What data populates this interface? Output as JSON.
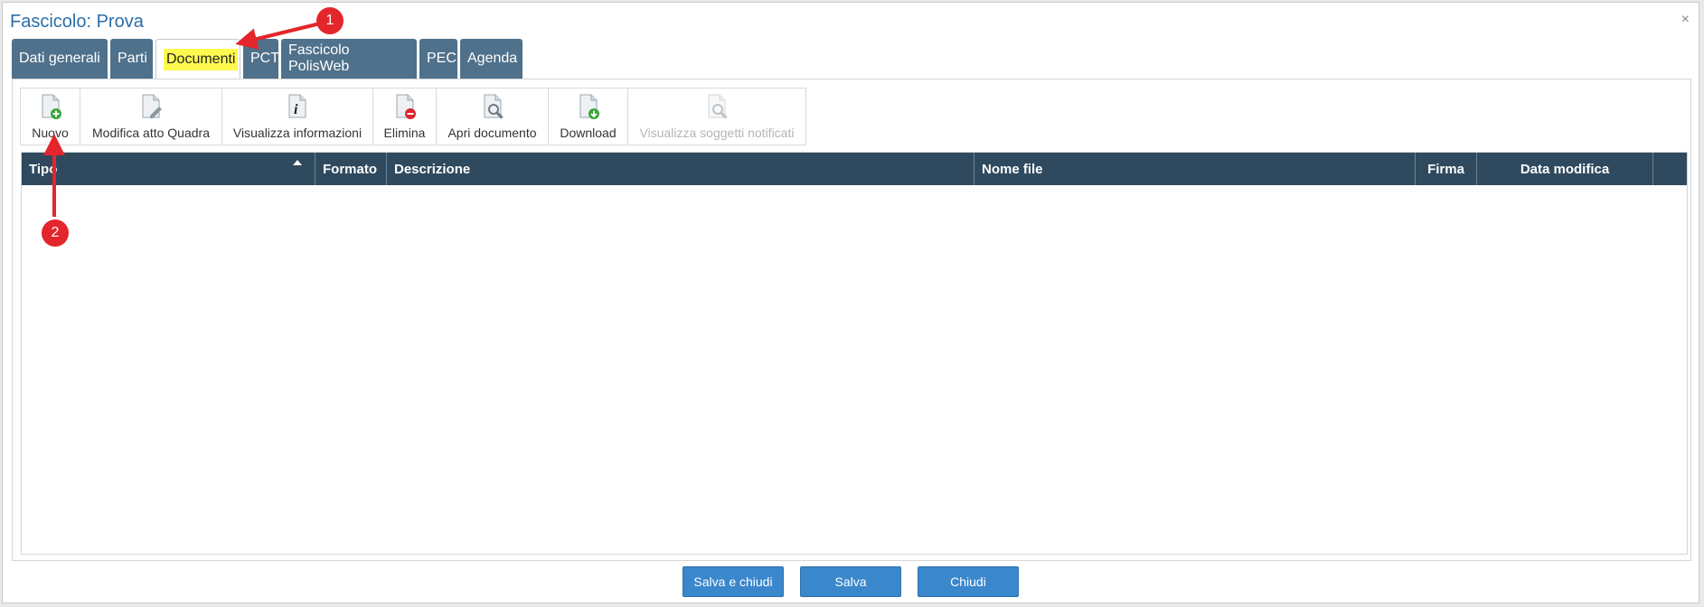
{
  "dialog": {
    "title": "Fascicolo: Prova",
    "close_glyph": "×"
  },
  "tabs": [
    {
      "label": "Dati generali",
      "active": false
    },
    {
      "label": "Parti",
      "active": false
    },
    {
      "label": "Documenti",
      "active": true
    },
    {
      "label": "PCT",
      "active": false
    },
    {
      "label": "Fascicolo PolisWeb",
      "active": false
    },
    {
      "label": "PEC",
      "active": false
    },
    {
      "label": "Agenda",
      "active": false
    }
  ],
  "toolbar": [
    {
      "label": "Nuovo",
      "icon": "doc-add-icon",
      "enabled": true
    },
    {
      "label": "Modifica atto Quadra",
      "icon": "doc-edit-icon",
      "enabled": true
    },
    {
      "label": "Visualizza informazioni",
      "icon": "doc-info-icon",
      "enabled": true
    },
    {
      "label": "Elimina",
      "icon": "doc-delete-icon",
      "enabled": true
    },
    {
      "label": "Apri documento",
      "icon": "doc-search-icon",
      "enabled": true
    },
    {
      "label": "Download",
      "icon": "doc-download-icon",
      "enabled": true
    },
    {
      "label": "Visualizza soggetti notificati",
      "icon": "doc-search-icon",
      "enabled": false
    }
  ],
  "grid": {
    "columns": [
      {
        "label": "Tipo",
        "sorted": "asc"
      },
      {
        "label": "Formato"
      },
      {
        "label": "Descrizione"
      },
      {
        "label": "Nome file"
      },
      {
        "label": "Firma"
      },
      {
        "label": "Data modifica"
      },
      {
        "label": ""
      }
    ],
    "rows": []
  },
  "footer": {
    "save_close": "Salva e chiudi",
    "save": "Salva",
    "close": "Chiudi"
  },
  "annotations": [
    "1",
    "2"
  ],
  "colors": {
    "tab_bg": "#4f718b",
    "header_bg": "#2f4a5e",
    "button_bg": "#3a87cc",
    "highlight": "#fff94f",
    "marker": "#e3262b",
    "title": "#2a6ea8"
  }
}
